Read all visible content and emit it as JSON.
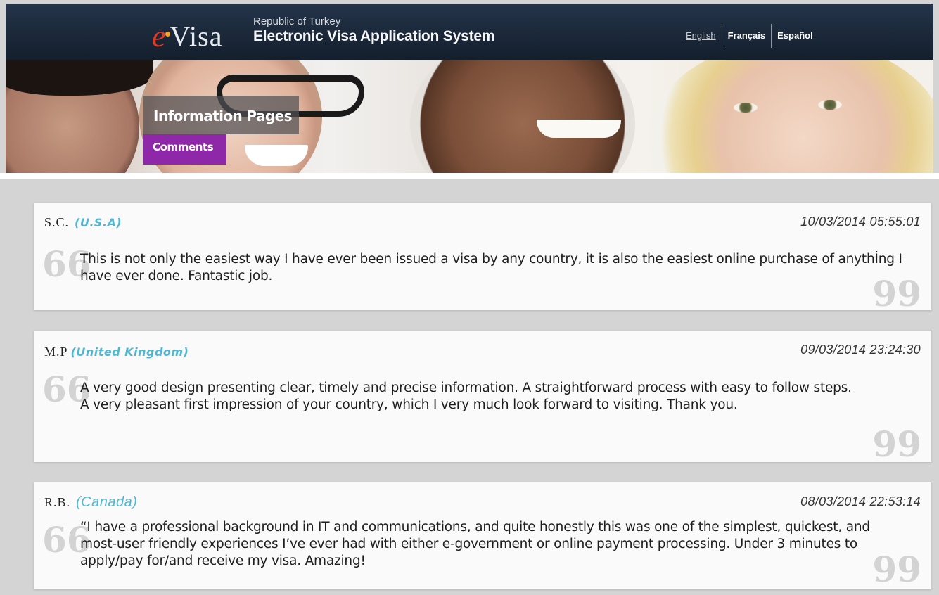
{
  "header": {
    "logo_e": "e",
    "logo_visa": "Visa",
    "subtitle": "Republic of Turkey",
    "title": "Electronic Visa Application System",
    "languages": [
      "English",
      "Français",
      "Español"
    ]
  },
  "hero": {
    "section_title": "Information Pages",
    "page_label": "Comments"
  },
  "comments": [
    {
      "author": "S.C.",
      "country": "(U.S.A)",
      "date": "10/03/2014 05:55:01",
      "text": "This is not only the easiest way I have ever been issued a visa by any country, it is also the easiest online purchase of anythİng I have ever done. Fantastic job."
    },
    {
      "author": "M.P",
      "country": "(United Kingdom)",
      "date": "09/03/2014 23:24:30",
      "text": "A very good design presenting clear, timely and precise information. A straightforward process with easy to follow steps. A very pleasant first impression of your country, which I very much look forward to visiting. Thank you."
    },
    {
      "author": "R.B.",
      "country": "(Canada)",
      "date": "08/03/2014 22:53:14",
      "text": "“I have a professional background in IT and communications, and quite honestly this was one of the simplest, quickest, and most-user friendly experiences I’ve ever had with either e-government or online payment processing. Under 3 minutes to apply/pay for/and receive my visa. Amazing!"
    }
  ],
  "quote_open": "66",
  "quote_close": "99",
  "colors": {
    "header_bg": "#1a2738",
    "accent_purple": "#8e28a8",
    "country_blue": "#4fb7d4",
    "logo_red": "#e03a25"
  }
}
